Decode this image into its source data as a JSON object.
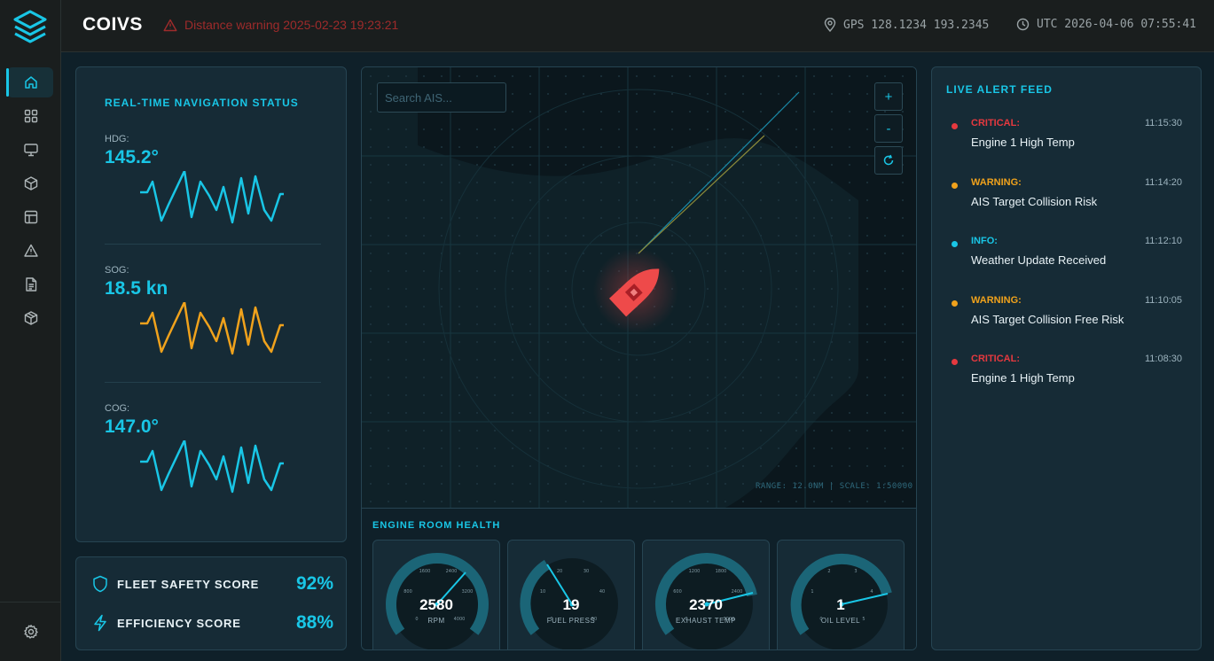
{
  "app": {
    "title": "COIVS"
  },
  "header": {
    "warning": "Distance warning 2025-02-23 19:23:21",
    "gps": "GPS 128.1234 193.2345",
    "utc": "UTC 2026-04-06 07:55:41"
  },
  "sidebar": {
    "items": [
      {
        "icon": "home-icon",
        "active": true
      },
      {
        "icon": "grid-icon",
        "active": false
      },
      {
        "icon": "monitor-icon",
        "active": false
      },
      {
        "icon": "cube-icon",
        "active": false
      },
      {
        "icon": "layout-icon",
        "active": false
      },
      {
        "icon": "alert-triangle-icon",
        "active": false
      },
      {
        "icon": "document-icon",
        "active": false
      },
      {
        "icon": "package-icon",
        "active": false
      }
    ],
    "settings_icon": "gear-icon"
  },
  "navigation": {
    "title": "REAL-TIME NAVIGATION STATUS",
    "metrics": [
      {
        "label": "HDG:",
        "value": "145.2°",
        "color": "#19c6e6"
      },
      {
        "label": "SOG:",
        "value": "18.5 kn",
        "color": "#f0a21c"
      },
      {
        "label": "COG:",
        "value": "147.0°",
        "color": "#19c6e6"
      }
    ]
  },
  "scores": [
    {
      "label": "FLEET SAFETY SCORE",
      "value": "92%",
      "icon": "shield-icon"
    },
    {
      "label": "EFFICIENCY SCORE",
      "value": "88%",
      "icon": "lightning-icon"
    }
  ],
  "map": {
    "search_placeholder": "Search AIS...",
    "zoom_in": "+",
    "zoom_out": "-",
    "reset_icon": "refresh-icon",
    "range_text": "RANGE: 12.0NM | SCALE: 1:50000"
  },
  "engine": {
    "title": "ENGINE ROOM HEALTH",
    "gauges": [
      {
        "value": "2580",
        "label": "RPM",
        "ticks": [
          "0",
          "800",
          "1600",
          "2400",
          "3200",
          "4000"
        ],
        "fraction": 0.64
      },
      {
        "value": "19",
        "label": "FUEL PRESS",
        "ticks": [
          "0",
          "10",
          "20",
          "30",
          "40",
          "50"
        ],
        "fraction": 0.38
      },
      {
        "value": "2370",
        "label": "EXHAUST TEMP",
        "ticks": [
          "0",
          "600",
          "1200",
          "1800",
          "2400",
          "3000"
        ],
        "fraction": 0.79
      },
      {
        "value": "1",
        "label": "OIL LEVEL",
        "ticks": [
          "0",
          "1",
          "2",
          "3",
          "4",
          "5"
        ],
        "fraction": 0.72
      }
    ]
  },
  "alerts": {
    "title": "LIVE ALERT FEED",
    "items": [
      {
        "severity": "CRITICAL:",
        "time": "11:15:30",
        "message": "Engine 1 High Temp",
        "color": "#e5393f"
      },
      {
        "severity": "WARNING:",
        "time": "11:14:20",
        "message": "AIS Target Collision Risk",
        "color": "#f0a21c"
      },
      {
        "severity": "INFO:",
        "time": "11:12:10",
        "message": "Weather Update Received",
        "color": "#19c6e6"
      },
      {
        "severity": "WARNING:",
        "time": "11:10:05",
        "message": "AIS Target Collision Free Risk",
        "color": "#f0a21c"
      },
      {
        "severity": "CRITICAL:",
        "time": "11:08:30",
        "message": "Engine 1 High Temp",
        "color": "#e5393f"
      }
    ]
  }
}
